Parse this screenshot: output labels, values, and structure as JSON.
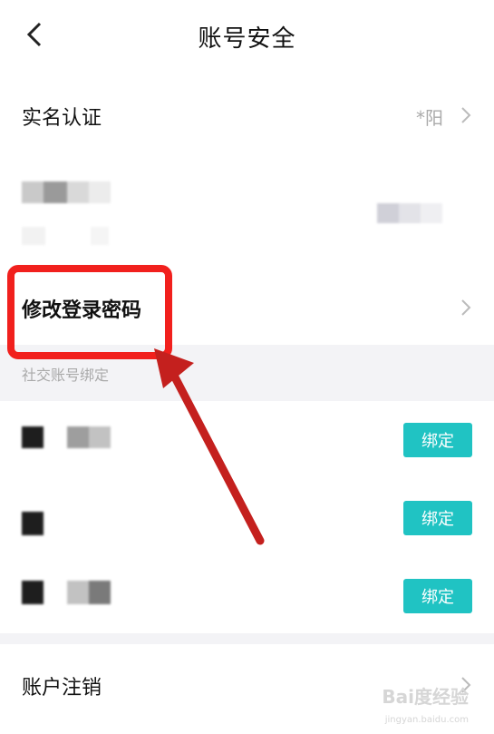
{
  "header": {
    "title": "账号安全"
  },
  "real_name": {
    "label": "实名认证",
    "value": "*阳"
  },
  "change_password": {
    "label": "修改登录密码"
  },
  "social": {
    "section_title": "社交账号绑定",
    "bind_label": "绑定"
  },
  "cancel_account": {
    "label": "账户注销"
  },
  "watermark": {
    "text": "Bai度经验",
    "sub": "jingyan.baidu.com"
  },
  "colors": {
    "accent": "#20c3c3",
    "highlight": "#f1201d",
    "arrow": "#c4201e",
    "section_bg": "#f3f3f6"
  }
}
